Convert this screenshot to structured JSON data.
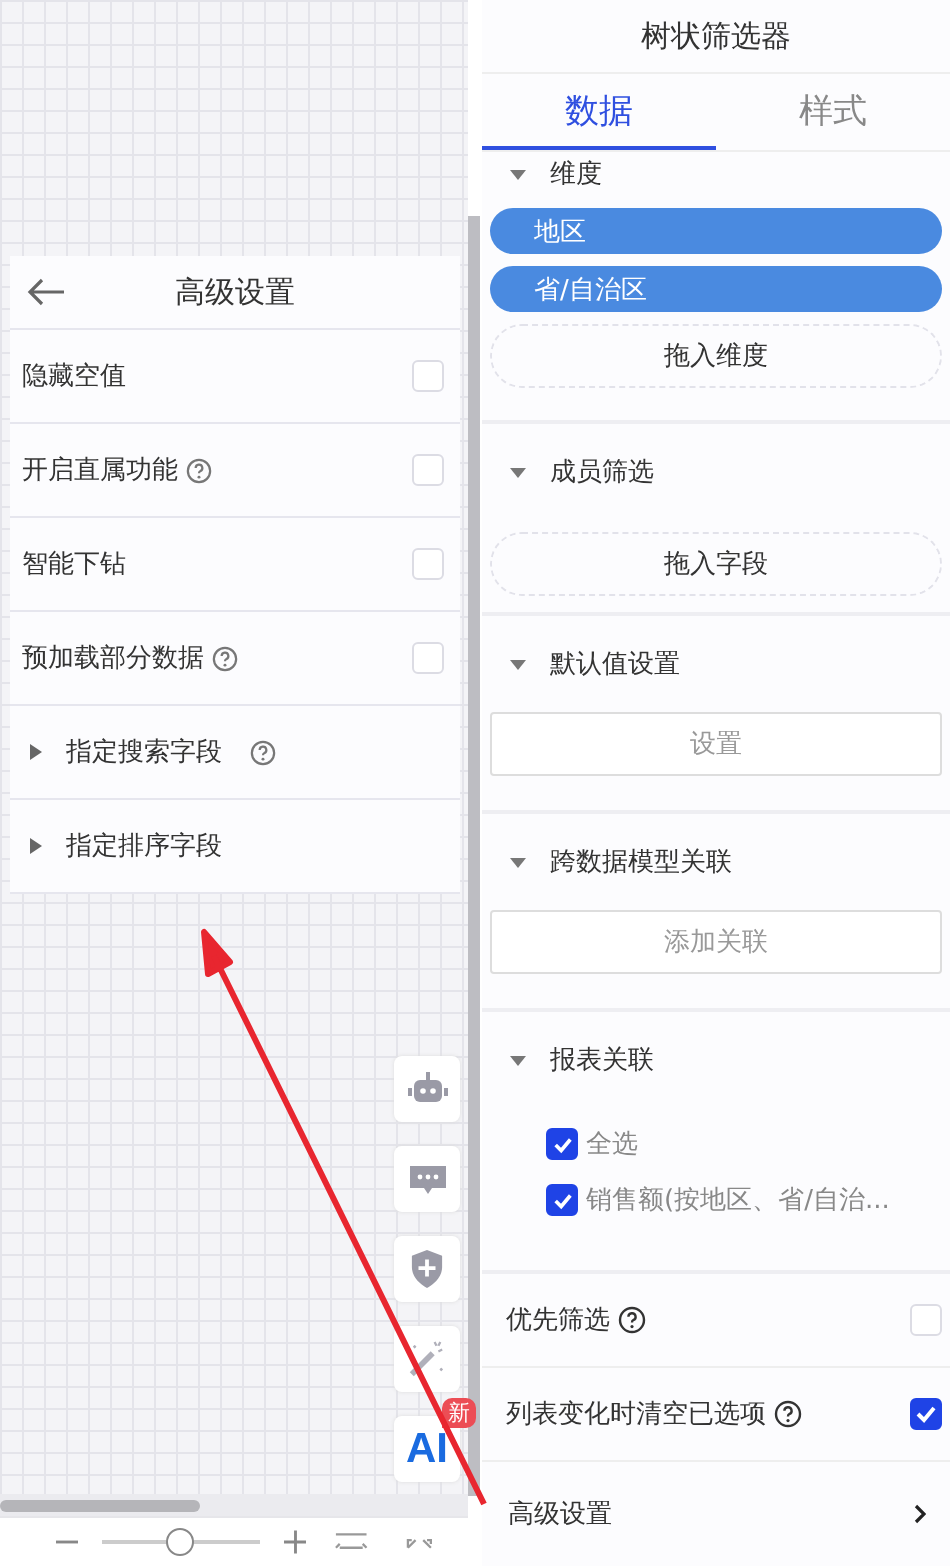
{
  "canvas_panel": {
    "title": "高级设置",
    "rows": [
      {
        "kind": "checkbox",
        "label": "隐藏空值",
        "help": false,
        "checked": false
      },
      {
        "kind": "checkbox",
        "label": "开启直属功能",
        "help": true,
        "checked": false
      },
      {
        "kind": "checkbox",
        "label": "智能下钻",
        "help": false,
        "checked": false
      },
      {
        "kind": "checkbox",
        "label": "预加载部分数据",
        "help": true,
        "checked": false
      },
      {
        "kind": "expander",
        "label": "指定搜索字段",
        "help": true,
        "expanded": false
      },
      {
        "kind": "expander",
        "label": "指定排序字段",
        "help": false,
        "expanded": false
      }
    ]
  },
  "floating_tools": [
    {
      "kind": "robot"
    },
    {
      "kind": "chat"
    },
    {
      "kind": "shield"
    },
    {
      "kind": "magic"
    },
    {
      "kind": "ai",
      "label": "AI",
      "badge": "新"
    }
  ],
  "zoom": {
    "level": 0.48
  },
  "panel": {
    "title": "树状筛选器",
    "tabs": [
      {
        "label": "数据",
        "selected": true
      },
      {
        "label": "样式",
        "selected": false
      }
    ],
    "sections": [
      {
        "kind": "fields",
        "title": "维度",
        "fields": [
          "地区",
          "省/自治区"
        ],
        "drop_hint": "拖入维度"
      },
      {
        "kind": "drop",
        "title": "成员筛选",
        "drop_hint": "拖入字段"
      },
      {
        "kind": "button",
        "title": "默认值设置",
        "button": "设置"
      },
      {
        "kind": "button",
        "title": "跨数据模型关联",
        "button": "添加关联"
      },
      {
        "kind": "checklist",
        "title": "报表关联",
        "items": [
          {
            "label": "全选",
            "checked": true
          },
          {
            "label": "销售额(按地区、省/自治...",
            "checked": true
          }
        ]
      }
    ],
    "options": [
      {
        "label": "优先筛选",
        "help": true,
        "checked": false
      },
      {
        "label": "列表变化时清空已选项",
        "help": true,
        "checked": true
      }
    ],
    "advanced": {
      "label": "高级设置"
    }
  }
}
